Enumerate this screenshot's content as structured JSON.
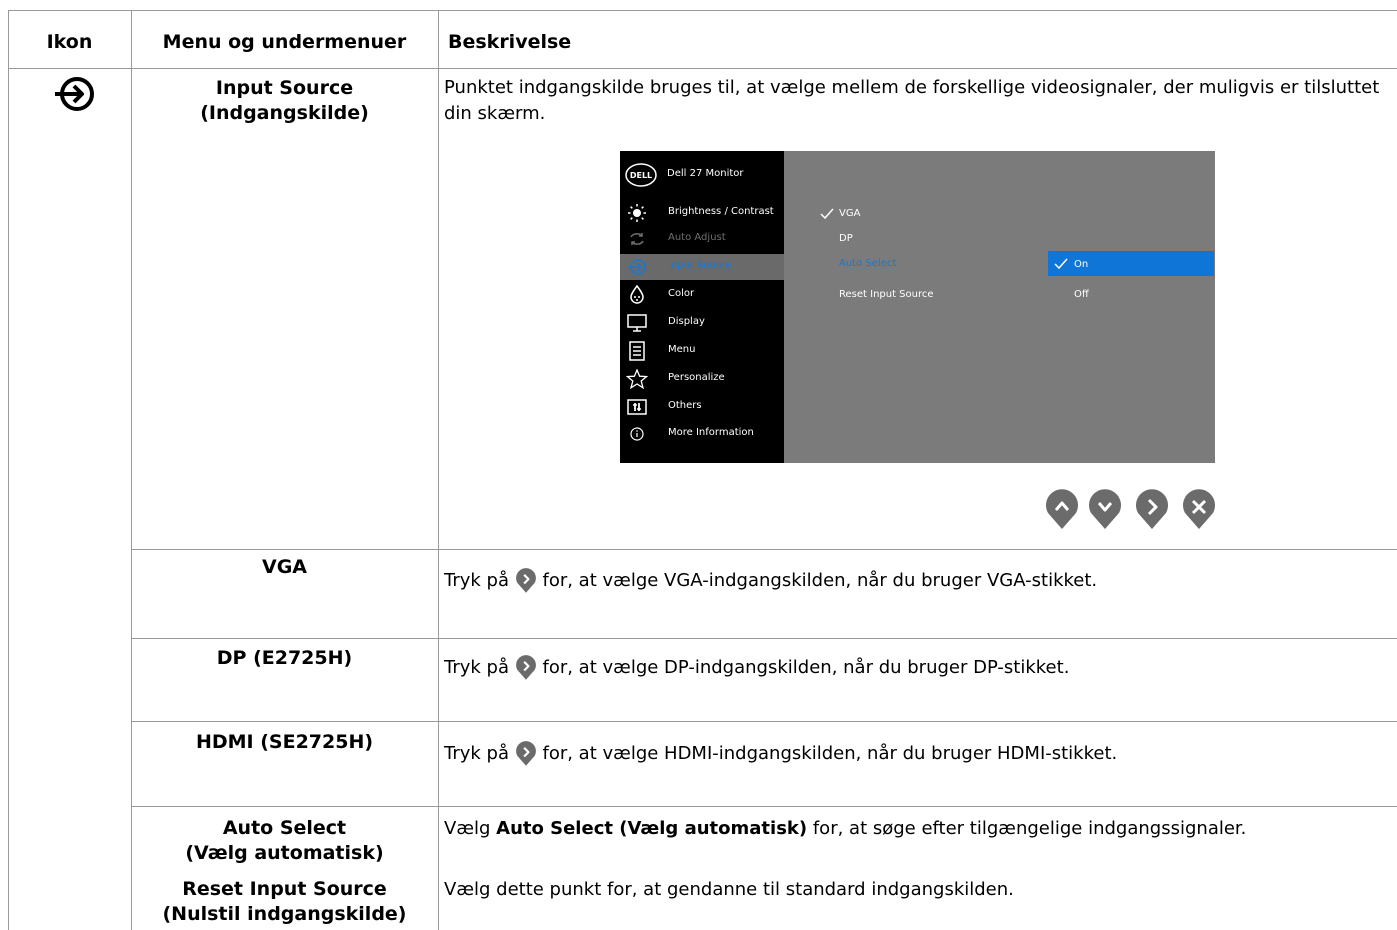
{
  "table": {
    "headers": {
      "icon": "Ikon",
      "menu": "Menu og undermenuer",
      "description": "Beskrivelse"
    },
    "rows": [
      {
        "menu_line1": "Input Source",
        "menu_line2": "(Indgangskilde)",
        "description": "Punktet indgangskilde bruges til, at vælge mellem de forskellige videosignaler, der muligvis er tilsluttet din skærm."
      },
      {
        "menu_line1": "VGA",
        "desc_pre": "Tryk på",
        "desc_post": "for, at vælge VGA-indgangskilden, når du bruger VGA-stikket."
      },
      {
        "menu_line1": "DP (E2725H)",
        "desc_pre": "Tryk på",
        "desc_post": "for, at vælge DP-indgangskilden, når du bruger DP-stikket."
      },
      {
        "menu_line1": "HDMI (SE2725H)",
        "desc_pre": "Tryk på",
        "desc_post": "for, at vælge HDMI-indgangskilden, når du bruger HDMI-stikket."
      },
      {
        "menu_line1": "Auto Select",
        "menu_line2": "(Vælg automatisk)",
        "desc_pre": "Vælg",
        "desc_bold": "Auto Select (Vælg automatisk)",
        "desc_post": "for, at søge efter tilgængelige indgangssignaler."
      },
      {
        "menu_line1": "Reset Input Source",
        "menu_line2": "(Nulstil indgangskilde)",
        "description": "Vælg dette punkt for, at gendanne til standard indgangskilden."
      }
    ]
  },
  "osd": {
    "logo": "DELL",
    "title": "Dell 27 Monitor",
    "menu": [
      {
        "label": "Brightness / Contrast",
        "icon": "brightness-icon",
        "state": "normal"
      },
      {
        "label": "Auto Adjust",
        "icon": "auto-adjust-icon",
        "state": "dim"
      },
      {
        "label": "Input Source",
        "icon": "input-source-icon",
        "state": "selected"
      },
      {
        "label": "Color",
        "icon": "color-icon",
        "state": "normal"
      },
      {
        "label": "Display",
        "icon": "display-icon",
        "state": "normal"
      },
      {
        "label": "Menu",
        "icon": "menu-icon",
        "state": "normal"
      },
      {
        "label": "Personalize",
        "icon": "star-icon",
        "state": "normal"
      },
      {
        "label": "Others",
        "icon": "others-icon",
        "state": "normal"
      },
      {
        "label": "More Information",
        "icon": "info-icon",
        "state": "normal"
      }
    ],
    "submenu": {
      "vga": "VGA",
      "dp": "DP",
      "auto_select": "Auto Select",
      "reset": "Reset Input Source"
    },
    "options": {
      "on": "On",
      "off": "Off"
    }
  },
  "nav_buttons": [
    "up-icon",
    "down-icon",
    "right-icon",
    "close-icon"
  ],
  "colors": {
    "highlight": "#0f75d6",
    "osd_panel": "#7b7b7b",
    "osd_sidebar": "#000000",
    "nav_button": "#6b6b6b"
  }
}
